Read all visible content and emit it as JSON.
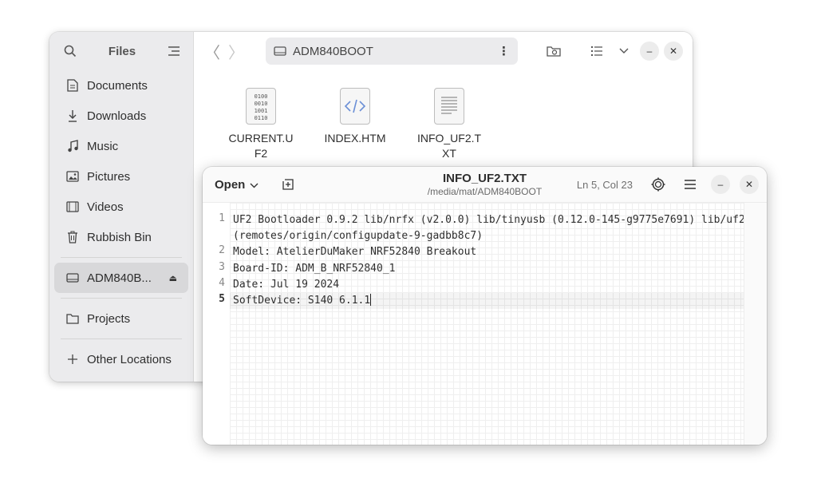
{
  "files_window": {
    "title": "Files",
    "sidebar": {
      "items": [
        {
          "label": "Documents",
          "icon": "document-icon"
        },
        {
          "label": "Downloads",
          "icon": "download-icon"
        },
        {
          "label": "Music",
          "icon": "music-icon"
        },
        {
          "label": "Pictures",
          "icon": "picture-icon"
        },
        {
          "label": "Videos",
          "icon": "video-icon"
        },
        {
          "label": "Rubbish Bin",
          "icon": "trash-icon"
        }
      ],
      "drive": {
        "label": "ADM840B...",
        "icon": "drive-icon"
      },
      "bookmarks": [
        {
          "label": "Projects",
          "icon": "folder-icon"
        }
      ],
      "other": {
        "label": "Other Locations",
        "icon": "plus-icon"
      }
    },
    "path": "ADM840BOOT",
    "files": [
      {
        "name": "CURRENT.UF2",
        "type": "binary"
      },
      {
        "name": "INDEX.HTM",
        "type": "html"
      },
      {
        "name": "INFO_UF2.TXT",
        "type": "text"
      }
    ]
  },
  "editor_window": {
    "open_label": "Open",
    "title": "INFO_UF2.TXT",
    "subtitle": "/media/mat/ADM840BOOT",
    "cursor_position": "Ln 5, Col 23",
    "lines": [
      {
        "num": "1",
        "text": "UF2 Bootloader 0.9.2 lib/nrfx (v2.0.0) lib/tinyusb (0.12.0-145-g9775e7691) lib/uf2"
      },
      {
        "num": "",
        "text": "(remotes/origin/configupdate-9-gadbb8c7)"
      },
      {
        "num": "2",
        "text": "Model: AtelierDuMaker NRF52840 Breakout"
      },
      {
        "num": "3",
        "text": "Board-ID: ADM_B_NRF52840_1"
      },
      {
        "num": "4",
        "text": "Date: Jul 19 2024"
      },
      {
        "num": "5",
        "text": "SoftDevice: S140 6.1.1"
      }
    ]
  }
}
